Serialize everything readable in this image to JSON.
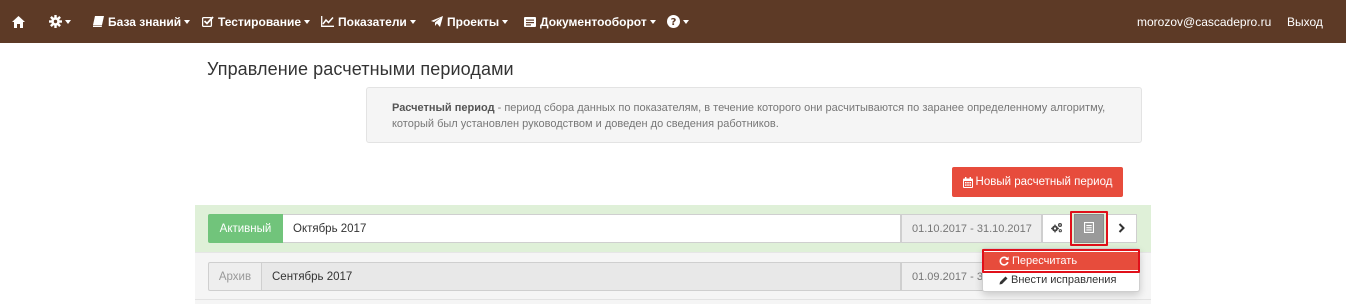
{
  "navbar": {
    "home_icon": "home-icon",
    "settings_icon": "gear-icon",
    "knowledge_base": "База знаний",
    "testing": "Тестирование",
    "indicators": "Показатели",
    "projects": "Проекты",
    "docflow": "Документооборот",
    "help_icon": "question-circle-icon",
    "user_email": "morozov@cascadepro.ru",
    "logout": "Выход"
  },
  "page": {
    "title": "Управление расчетными периодами",
    "info_bold": "Расчетный период",
    "info_text": " - период сбора данных по показателям, в течение которого они расчитываются по заранее определенному алгоритму, который был установлен руководством и доведен до сведения работников."
  },
  "new_period_button": "Новый расчетный период",
  "periods": [
    {
      "status": "Активный",
      "name": "Октябрь 2017",
      "dates": "01.10.2017 - 31.10.2017"
    },
    {
      "status": "Архив",
      "name": "Сентябрь 2017",
      "dates": "01.09.2017 - 3"
    }
  ],
  "dropdown": {
    "recalculate": "Пересчитать",
    "make_corrections": "Внести исправления"
  },
  "colors": {
    "navbar": "#5d3a26",
    "accent_red": "#e74c3c",
    "active_green": "#71c47b",
    "active_row": "#dff0d8",
    "highlight": "#e0101a"
  }
}
